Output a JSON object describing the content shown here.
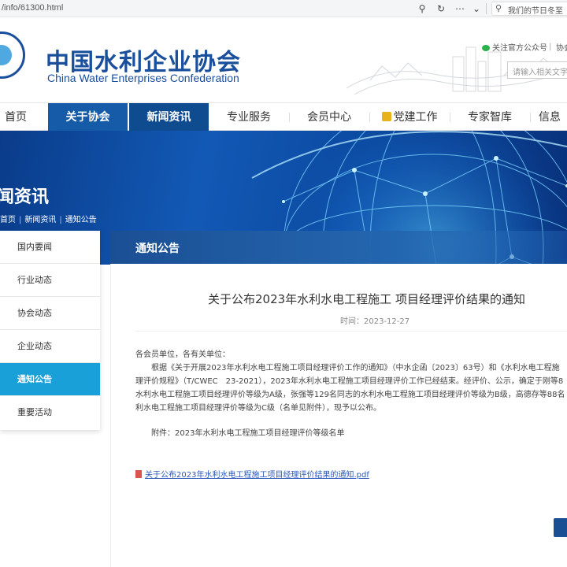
{
  "browser": {
    "url": "/info/61300.html",
    "search_placeholder": "我们的节日冬至"
  },
  "header": {
    "title_cn": "中国水利企业协会",
    "title_en": "China Water Enterprises Confederation",
    "wechat_label": "关注官方公众号",
    "separator": "|",
    "assoc_label": "协会",
    "search_placeholder": "请输入相关文字..."
  },
  "nav": {
    "items": [
      {
        "label": "首页"
      },
      {
        "label": "关于协会"
      },
      {
        "label": "新闻资讯"
      },
      {
        "label": "专业服务"
      },
      {
        "label": "会员中心"
      },
      {
        "label": "党建工作"
      },
      {
        "label": "专家智库"
      },
      {
        "label": "信息"
      }
    ]
  },
  "banner": {
    "title": "闻资讯",
    "breadcrumb": [
      "首页",
      "新闻资讯",
      "通知公告"
    ],
    "breadcrumb_sep": "|"
  },
  "sidebar": {
    "items": [
      {
        "label": "国内要闻"
      },
      {
        "label": "行业动态"
      },
      {
        "label": "协会动态"
      },
      {
        "label": "企业动态"
      },
      {
        "label": "通知公告"
      },
      {
        "label": "重要活动"
      }
    ],
    "active_index": 4
  },
  "content": {
    "section_title": "通知公告",
    "article_title": "关于公布2023年水利水电工程施工 项目经理评价结果的通知",
    "time": "时间：2023-12-27",
    "paragraphs": [
      "各会员单位，各有关单位：",
      "　　根据《关于开展2023年水利水电工程施工项目经理评价工作的通知》（中水企函〔2023〕63号）和《水利水电工程施",
      "理评价规程》（T/CWEC　23-2021），2023年水利水电工程施工项目经理评价工作已经结束。经评价、公示，确定于刚等8",
      "水利水电工程施工项目经理评价等级为A级，张强等129名同志的水利水电工程施工项目经理评价等级为B级，高德存等88名",
      "利水电工程施工项目经理评价等级为C级（名单见附件），现予以公布。"
    ],
    "attachment": "附件：2023年水利水电工程施工项目经理评价等级名单",
    "pdf_link": "关于公布2023年水利水电工程施工项目经理评价结果的通知.pdf"
  },
  "colors": {
    "brand_blue": "#1a4f9c",
    "nav_active": "#155ba8",
    "sidebar_active": "#1aa0d8",
    "link": "#2a57b8"
  }
}
